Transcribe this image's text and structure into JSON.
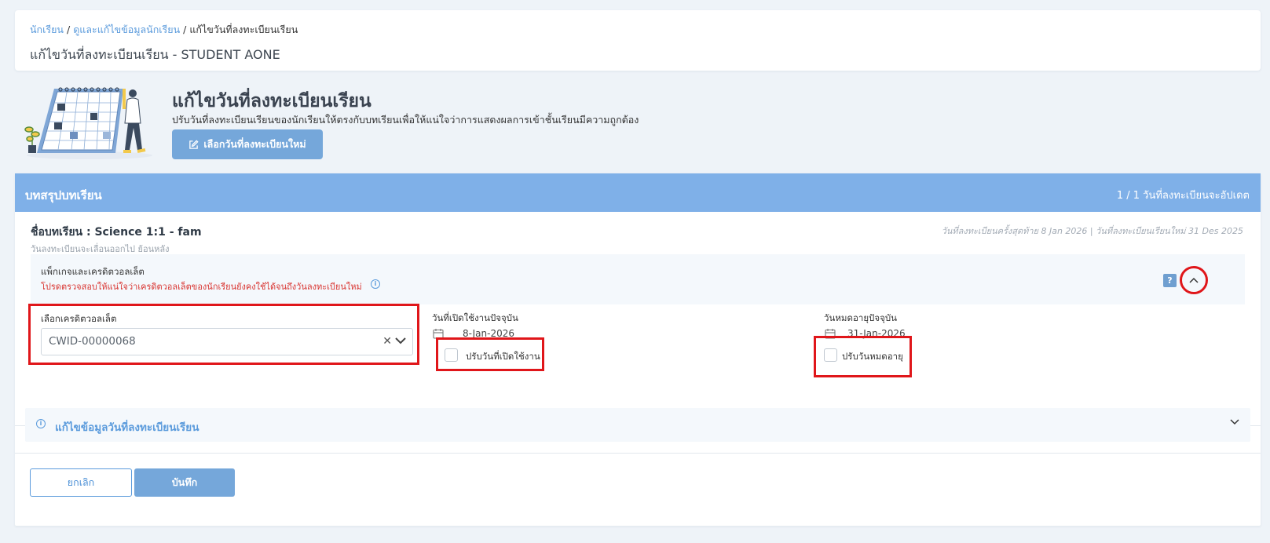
{
  "breadcrumb": {
    "items": [
      "นักเรียน",
      "ดูและแก้ไขข้อมูลนักเรียน",
      "แก้ไขวันที่ลงทะเบียนเรียน"
    ]
  },
  "page": {
    "title": "แก้ไขวันที่ลงทะเบียนเรียน - STUDENT AONE"
  },
  "hero": {
    "title": "แก้ไขวันที่ลงทะเบียนเรียน",
    "description": "ปรับวันที่ลงทะเบียนเรียนของนักเรียนให้ตรงกับบทเรียนเพื่อให้แน่ใจว่าการแสดงผลการเข้าชั้นเรียนมีความถูกต้อง",
    "button_label": "เลือกวันที่ลงทะเบียนใหม่"
  },
  "summary": {
    "title": "บทสรุปบทเรียน",
    "count_text": "1 / 1 วันที่ลงทะเบียนจะอัปเดต",
    "course": {
      "name": "ชื่อบทเรียน : Science 1:1 - fam",
      "subtitle": "วันลงทะเบียนจะเลื่อนออกไป ย้อนหลัง",
      "dates_text": "วันที่ลงทะเบียนครั้งสุดท้าย 8 Jan 2026 | วันที่ลงทะเบียนเรียนใหม่ 31 Des 2025"
    },
    "package": {
      "title": "แพ็กเกจและเครดิตวอลเล็ต",
      "warning": "โปรดตรวจสอบให้แน่ใจว่าเครดิตวอลเล็ตของนักเรียนยังคงใช้ได้จนถึงวันลงทะเบียนใหม่",
      "help_label": "?"
    },
    "credit": {
      "label": "เลือกเครดิตวอลเล็ต",
      "selected": "CWID-00000068",
      "clear_symbol": "✕"
    },
    "start_date": {
      "label": "วันที่เปิดใช้งานปัจจุบัน",
      "value": "8-Jan-2026",
      "checkbox_label": "ปรับวันที่เปิดใช้งาน"
    },
    "expiry_date": {
      "label": "วันหมดอายุปัจจุบัน",
      "value": "31-Jan-2026",
      "checkbox_label": "ปรับวันหมดอายุ"
    },
    "edit_section": {
      "title": "แก้ไขข้อมูลวันที่ลงทะเบียนเรียน",
      "info_symbol": "i"
    }
  },
  "footer": {
    "cancel_label": "ยกเลิก",
    "save_label": "บันทึก"
  },
  "colors": {
    "accent": "#7fb0e8",
    "button": "#75a7da",
    "link": "#5b9bdc",
    "warning": "#d9332f",
    "highlight": "#e0161a"
  },
  "icons": [
    "calendar-illustration",
    "edit-icon",
    "info-icon",
    "help-icon",
    "chevron-up-icon",
    "chevron-down-icon",
    "calendar-icon",
    "clear-icon"
  ]
}
